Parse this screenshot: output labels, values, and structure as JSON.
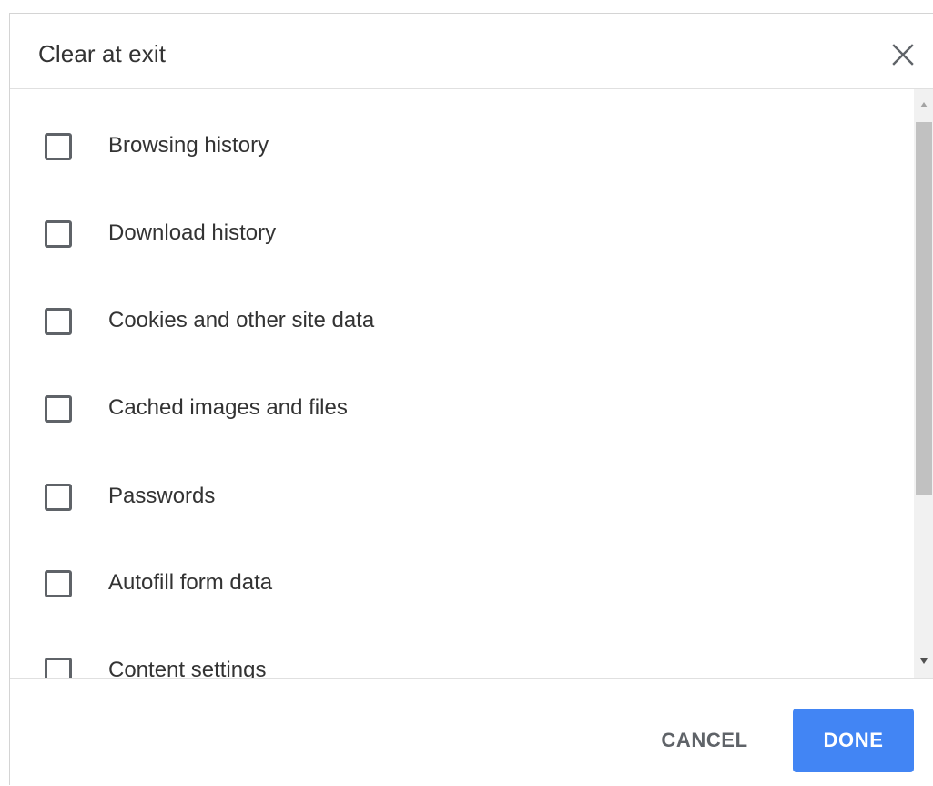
{
  "dialog": {
    "title": "Clear at exit",
    "close_icon": "close-icon"
  },
  "options": [
    {
      "label": "Browsing history",
      "checked": false
    },
    {
      "label": "Download history",
      "checked": false
    },
    {
      "label": "Cookies and other site data",
      "checked": false
    },
    {
      "label": "Cached images and files",
      "checked": false
    },
    {
      "label": "Passwords",
      "checked": false
    },
    {
      "label": "Autofill form data",
      "checked": false
    },
    {
      "label": "Content settings",
      "checked": false
    }
  ],
  "footer": {
    "cancel_label": "CANCEL",
    "done_label": "DONE"
  },
  "colors": {
    "accent": "#4285f4",
    "text": "#333333",
    "checkbox_border": "#5f6368"
  }
}
